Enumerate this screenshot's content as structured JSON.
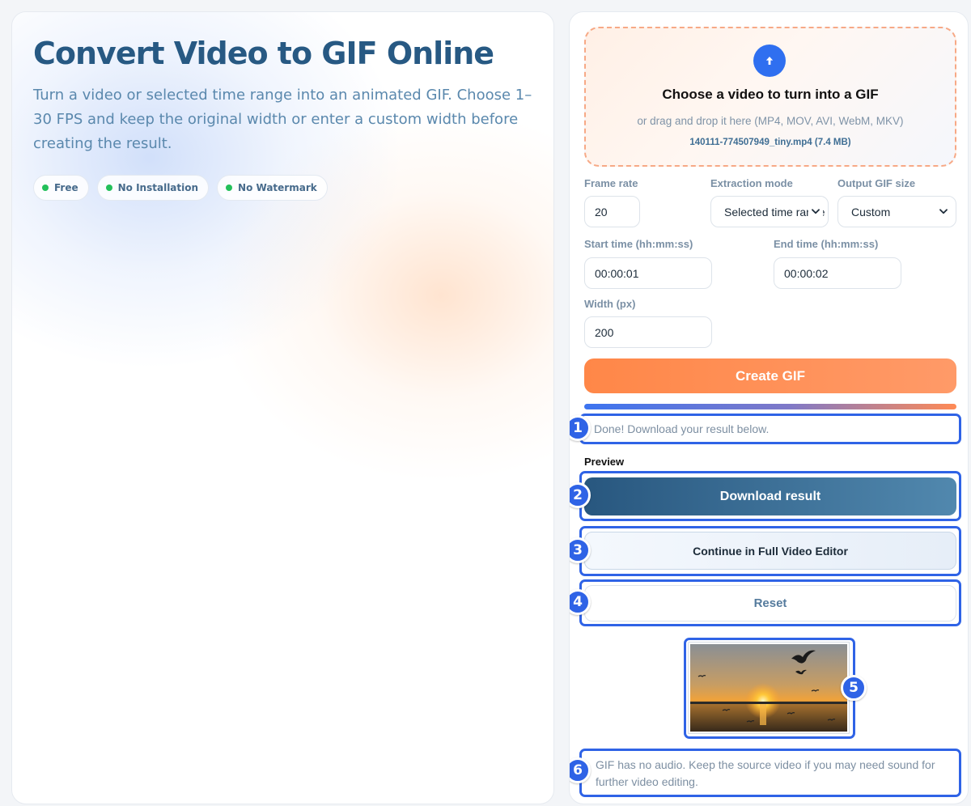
{
  "hero": {
    "title": "Convert Video to GIF Online",
    "description": "Turn a video or selected time range into an animated GIF. Choose 1–30 FPS and keep the original width or enter a custom width before creating the result.",
    "badges": [
      "Free",
      "No Installation",
      "No Watermark"
    ]
  },
  "upload": {
    "icon": "arrow-up-icon",
    "title": "Choose a video to turn into a GIF",
    "subtitle": "or drag and drop it here (MP4, MOV, AVI, WebM, MKV)",
    "file": "140111-774507949_tiny.mp4 (7.4 MB)"
  },
  "form": {
    "frame_rate_label": "Frame rate",
    "frame_rate_value": "20",
    "extraction_mode_label": "Extraction mode",
    "extraction_mode_value": "Selected time range",
    "output_size_label": "Output GIF size",
    "output_size_value": "Custom",
    "start_time_label": "Start time (hh:mm:ss)",
    "start_time_value": "00:00:01",
    "end_time_label": "End time (hh:mm:ss)",
    "end_time_value": "00:00:02",
    "width_label": "Width (px)",
    "width_value": "200"
  },
  "actions": {
    "create_label": "Create GIF",
    "progress": 1.0,
    "status": "Done! Download your result below.",
    "preview_label": "Preview",
    "download_label": "Download result",
    "continue_label": "Continue in Full Video Editor",
    "reset_label": "Reset"
  },
  "note": "GIF has no audio. Keep the source video if you may need sound for further video editing.",
  "annotations": [
    "1",
    "2",
    "3",
    "4",
    "5",
    "6"
  ],
  "colors": {
    "brand_blue": "#275983",
    "accent_orange": "#ff8748",
    "annotation_blue": "#2f63e6",
    "badge_green": "#23c05a"
  }
}
